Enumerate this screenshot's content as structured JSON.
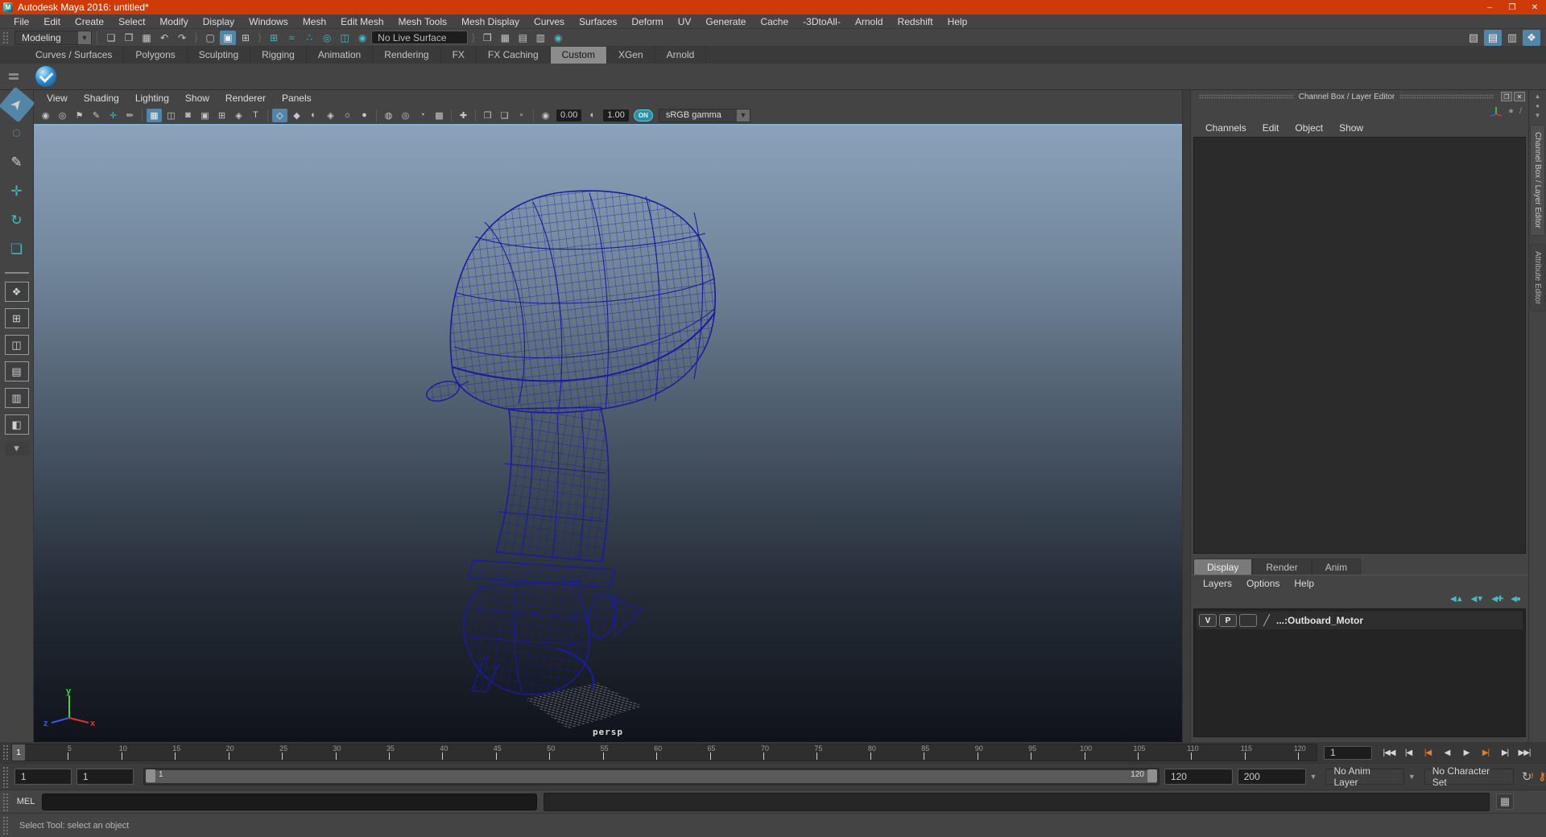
{
  "colors": {
    "titlebar": "#ce3b09",
    "selection": "#5285a6",
    "teal": "#48b8c2",
    "orange": "#e8792e",
    "wireframe": "#1b1b9e"
  },
  "window": {
    "title": "Autodesk Maya 2016: untitled*",
    "logo_letter": "M",
    "minimize": "–",
    "maximize": "❐",
    "close": "✕"
  },
  "menubar": {
    "items": [
      "File",
      "Edit",
      "Create",
      "Select",
      "Modify",
      "Display",
      "Windows",
      "Mesh",
      "Edit Mesh",
      "Mesh Tools",
      "Mesh Display",
      "Curves",
      "Surfaces",
      "Deform",
      "UV",
      "Generate",
      "Cache",
      "-3DtoAll-",
      "Arnold",
      "Redshift",
      "Help"
    ]
  },
  "toolbar": {
    "mode_selector": "Modeling",
    "live_surface": "No Live Surface",
    "file_icons": [
      {
        "name": "new-scene",
        "glyph": "❏"
      },
      {
        "name": "open-scene",
        "glyph": "❒"
      },
      {
        "name": "save-scene",
        "glyph": "▦"
      },
      {
        "name": "undo",
        "glyph": "↶"
      },
      {
        "name": "redo",
        "glyph": "↷"
      }
    ],
    "selection_mode_icons": [
      {
        "name": "select-hierarchy",
        "glyph": "▢"
      },
      {
        "name": "select-object",
        "glyph": "▣",
        "active": true
      },
      {
        "name": "select-component",
        "glyph": "⊞"
      }
    ],
    "snap_icons": [
      {
        "name": "snap-to-grids",
        "glyph": "⊞"
      },
      {
        "name": "snap-to-curves",
        "glyph": "≈"
      },
      {
        "name": "snap-to-points",
        "glyph": "∴"
      },
      {
        "name": "snap-to-projected-center",
        "glyph": "◎"
      },
      {
        "name": "snap-to-view-planes",
        "glyph": "◫"
      },
      {
        "name": "make-live",
        "glyph": "◉"
      }
    ],
    "render_icons": [
      {
        "name": "render-view",
        "glyph": "❒"
      },
      {
        "name": "render-current-frame",
        "glyph": "▦"
      },
      {
        "name": "ipr-render",
        "glyph": "▤"
      },
      {
        "name": "render-settings",
        "glyph": "▥"
      },
      {
        "name": "hypershade",
        "glyph": "◉",
        "teal": true
      }
    ],
    "sidebar_icons": [
      {
        "name": "modeling-toolkit",
        "glyph": "▧"
      },
      {
        "name": "attribute-editor",
        "glyph": "▤",
        "active": true
      },
      {
        "name": "tool-settings",
        "glyph": "▥"
      },
      {
        "name": "channel-box-toggle",
        "glyph": "❖",
        "active": true
      }
    ]
  },
  "shelf": {
    "tabs": [
      {
        "label": "Curves / Surfaces"
      },
      {
        "label": "Polygons"
      },
      {
        "label": "Sculpting"
      },
      {
        "label": "Rigging"
      },
      {
        "label": "Animation"
      },
      {
        "label": "Rendering"
      },
      {
        "label": "FX"
      },
      {
        "label": "FX Caching"
      },
      {
        "label": "Custom",
        "active": true
      },
      {
        "label": "XGen"
      },
      {
        "label": "Arnold"
      }
    ]
  },
  "toolbox": {
    "tools": [
      {
        "name": "select-tool",
        "glyph": "➤",
        "active": true
      },
      {
        "name": "lasso-select-tool",
        "glyph": "◌"
      },
      {
        "name": "paint-select-tool",
        "glyph": "✎"
      },
      {
        "name": "move-tool",
        "glyph": "✛",
        "teal": true
      },
      {
        "name": "rotate-tool",
        "glyph": "↻",
        "teal": true
      },
      {
        "name": "scale-tool",
        "glyph": "❏",
        "teal": true
      }
    ],
    "layout_icons": [
      {
        "name": "layout-single-pane",
        "glyph": "❖"
      },
      {
        "name": "layout-four-view",
        "glyph": "⊞"
      },
      {
        "name": "layout-persp-outliner",
        "glyph": "◫"
      },
      {
        "name": "layout-persp-graph",
        "glyph": "▤"
      },
      {
        "name": "layout-hypershade-persp",
        "glyph": "▥"
      },
      {
        "name": "layout-persp-uv",
        "glyph": "◧"
      }
    ]
  },
  "viewport": {
    "menus": [
      "View",
      "Shading",
      "Lighting",
      "Show",
      "Renderer",
      "Panels"
    ],
    "icons": [
      {
        "name": "select-camera",
        "glyph": "◉"
      },
      {
        "name": "camera-attributes",
        "glyph": "◎"
      },
      {
        "name": "bookmark",
        "glyph": "⚑"
      },
      {
        "name": "grease-pencil",
        "glyph": "✎"
      },
      {
        "name": "camera-pivot",
        "glyph": "✛",
        "teal": true
      },
      {
        "name": "image-plane",
        "glyph": "✏"
      },
      {
        "sep": true
      },
      {
        "name": "grid-toggle",
        "glyph": "▦",
        "active": true
      },
      {
        "name": "film-gate",
        "glyph": "◫"
      },
      {
        "name": "resolution-gate",
        "glyph": "◙"
      },
      {
        "name": "gate-mask",
        "glyph": "▣"
      },
      {
        "name": "field-chart",
        "glyph": "⊞"
      },
      {
        "name": "safe-action",
        "glyph": "◈"
      },
      {
        "name": "safe-title",
        "glyph": "T"
      },
      {
        "sep": true
      },
      {
        "name": "wireframe-display",
        "glyph": "◇",
        "active": true
      },
      {
        "name": "shaded-display",
        "glyph": "◆"
      },
      {
        "name": "textured-display",
        "glyph": "◐"
      },
      {
        "name": "use-default-material",
        "glyph": "◈"
      },
      {
        "name": "lighting-toggle",
        "glyph": "☼"
      },
      {
        "name": "shadows-toggle",
        "glyph": "●"
      },
      {
        "sep": true
      },
      {
        "name": "ambient-occlusion",
        "glyph": "◍"
      },
      {
        "name": "motion-blur",
        "glyph": "◎"
      },
      {
        "name": "depth-of-field",
        "glyph": "◔"
      },
      {
        "name": "multisample-aa",
        "glyph": "▩"
      },
      {
        "sep": true
      },
      {
        "name": "isolate-select",
        "glyph": "✚"
      },
      {
        "sep": true
      },
      {
        "name": "pane-layout-previous",
        "glyph": "❐"
      },
      {
        "name": "pane-layout-next",
        "glyph": "❏"
      },
      {
        "name": "low-res-preview",
        "glyph": "▫"
      }
    ],
    "exposure": "0.00",
    "gamma": "1.00",
    "gamma_toggle": "ON",
    "color_space": "sRGB gamma",
    "camera_label": "persp",
    "axis": {
      "x": "x",
      "y": "y",
      "z": "z"
    }
  },
  "channel_box": {
    "title": "Channel Box / Layer Editor",
    "menus": [
      "Channels",
      "Edit",
      "Object",
      "Show"
    ]
  },
  "layer_editor": {
    "tabs": [
      {
        "label": "Display",
        "active": true
      },
      {
        "label": "Render"
      },
      {
        "label": "Anim"
      }
    ],
    "menus": [
      "Layers",
      "Options",
      "Help"
    ],
    "icons": [
      {
        "name": "move-layer-up",
        "glyph": "◀▲"
      },
      {
        "name": "move-layer-down",
        "glyph": "◀▼"
      },
      {
        "name": "new-empty-layer",
        "glyph": "◀✚"
      },
      {
        "name": "new-layer-from-selected",
        "glyph": "◀●"
      }
    ],
    "layers": [
      {
        "visible": "V",
        "playback": "P",
        "name": "...:Outboard_Motor"
      }
    ]
  },
  "side_tabs": [
    "Channel Box / Layer Editor",
    "Attribute Editor"
  ],
  "timeline": {
    "current_frame": "1",
    "start": 1,
    "end": 120,
    "ticks": [
      5,
      10,
      15,
      20,
      25,
      30,
      35,
      40,
      45,
      50,
      55,
      60,
      65,
      70,
      75,
      80,
      85,
      90,
      95,
      100,
      105,
      110,
      115,
      120
    ],
    "frame_field": "1",
    "playback_icons": [
      {
        "name": "go-to-start",
        "glyph": "|◀◀"
      },
      {
        "name": "step-back-frame",
        "glyph": "|◀"
      },
      {
        "name": "step-back-key",
        "glyph": "|◀",
        "orange": true
      },
      {
        "name": "play-backwards",
        "glyph": "◀"
      },
      {
        "name": "play-forwards",
        "glyph": "▶"
      },
      {
        "name": "step-forward-key",
        "glyph": "▶|",
        "orange": true
      },
      {
        "name": "step-forward-frame",
        "glyph": "▶|"
      },
      {
        "name": "go-to-end",
        "glyph": "▶▶|"
      }
    ]
  },
  "range_slider": {
    "anim_start": "1",
    "playback_start": "1",
    "range_start_label": "1",
    "range_end_label": "120",
    "playback_end": "120",
    "anim_end": "200",
    "anim_layer": "No Anim Layer",
    "character_set": "No Character Set"
  },
  "command_line": {
    "label": "MEL",
    "input_value": ""
  },
  "help_line": {
    "text": "Select Tool: select an object"
  }
}
